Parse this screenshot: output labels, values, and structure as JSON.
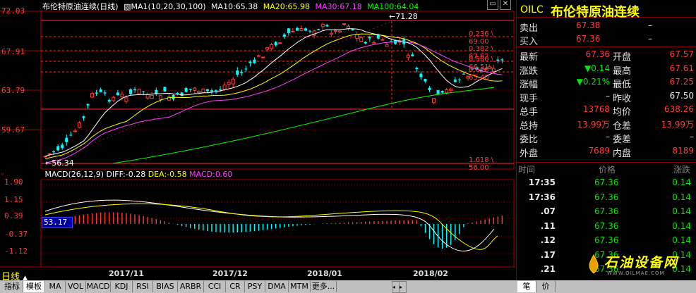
{
  "chart": {
    "title": "布伦特原油连续(日线)",
    "ma_legend": [
      {
        "label": "MA1(10,20,30,100)",
        "color": "#ffffff"
      },
      {
        "label": "MA10:65.38",
        "color": "#ffffff"
      },
      {
        "label": "MA20:65.98",
        "color": "#ffff00"
      },
      {
        "label": "MA30:67.18",
        "color": "#ff40ff"
      },
      {
        "label": "MA100:64.04",
        "color": "#00ff00"
      }
    ],
    "price_axis": [
      "72.03",
      "67.91",
      "63.79",
      "59.67"
    ],
    "high_label": "71.28",
    "low_label": "56.34",
    "fib_labels": [
      "0.236 \\ 69.00",
      "0.382 \\ 67.62",
      "0.500 \\ 66.51",
      "0.618 \\ 65.40",
      "1.618 \\ 56.00"
    ],
    "macd_legend": [
      {
        "label": "MACD(26,12,9)",
        "color": "#ffffff"
      },
      {
        "label": "DIFF:-0.28",
        "color": "#ffffff"
      },
      {
        "label": "DEA:-0.58",
        "color": "#ffff00"
      },
      {
        "label": "MACD:0.60",
        "color": "#ff40ff"
      }
    ],
    "macd_axis": [
      "1.90",
      "1.15",
      "0.39",
      "-0.37",
      "-1.12"
    ],
    "cursor_value": "53.17",
    "date_labels": [
      "2017/11",
      "2017/12",
      "2018/01",
      "2018/02"
    ],
    "period_label": "日线",
    "win_buttons": [
      "▭",
      "✕"
    ]
  },
  "quote": {
    "code": "OILC",
    "name": "布伦特原油连续",
    "sell": {
      "label": "卖出",
      "price": "67.38",
      "vol": "–"
    },
    "buy": {
      "label": "买入",
      "price": "67.36",
      "vol": "–"
    },
    "rows": [
      {
        "l1": "最新",
        "v1": "67.36",
        "c1": "red",
        "l2": "开盘",
        "v2": "67.57",
        "c2": "red"
      },
      {
        "l1": "涨跌",
        "v1": "▼0.14",
        "c1": "green",
        "l2": "最高",
        "v2": "67.61",
        "c2": "red"
      },
      {
        "l1": "涨幅",
        "v1": "▼0.21%",
        "c1": "green",
        "l2": "最低",
        "v2": "67.25",
        "c2": "red"
      },
      {
        "l1": "现手",
        "v1": "–",
        "c1": "white",
        "l2": "昨收",
        "v2": "67.50",
        "c2": "white"
      },
      {
        "l1": "总手",
        "v1": "13768",
        "c1": "red",
        "l2": "均价",
        "v2": "638.26",
        "c2": "red"
      },
      {
        "l1": "总持",
        "v1": "13.99万",
        "c1": "red",
        "l2": "仓差",
        "v2": "13.99万",
        "c2": "red"
      },
      {
        "l1": "委比",
        "v1": "–",
        "c1": "white",
        "l2": "委差",
        "v2": "–",
        "c2": "white"
      },
      {
        "l1": "外盘",
        "v1": "7689",
        "c1": "red",
        "l2": "内盘",
        "v2": "8189",
        "c2": "red"
      }
    ],
    "tick_header": {
      "time": "时间",
      "price": "价格",
      "change": "涨跌"
    },
    "ticks": [
      {
        "time": "17:35",
        "price": "67.36",
        "change": "0.14"
      },
      {
        "time": "17:36",
        "price": "67.36",
        "change": "0.14"
      },
      {
        "time": ".07",
        "price": "67.36",
        "change": "0.14"
      },
      {
        "time": ".11",
        "price": "67.36",
        "change": "0.14"
      },
      {
        "time": ".12",
        "price": "67.36",
        "change": "0.14"
      },
      {
        "time": ".17",
        "price": "67.36",
        "change": "0.14"
      },
      {
        "time": ".21",
        "price": "67.36",
        "change": "0.14"
      }
    ],
    "watermark_cn": "石油设备网",
    "watermark_url": "WWW.OILMAE.COM"
  },
  "tabs": [
    "指标",
    "模板",
    "MA",
    "VOL",
    "MACD",
    "KDJ",
    "RSI",
    "BIAS",
    "ARBR",
    "CCI",
    "CR",
    "PSY",
    "DMA",
    "MTM",
    "更多..."
  ],
  "right_tabs": [
    "笔",
    "价"
  ],
  "colors": {
    "up": "#ff3c3c",
    "down": "#00ffff",
    "grid_red": "#a00000",
    "ma100": "#00ff00"
  }
}
